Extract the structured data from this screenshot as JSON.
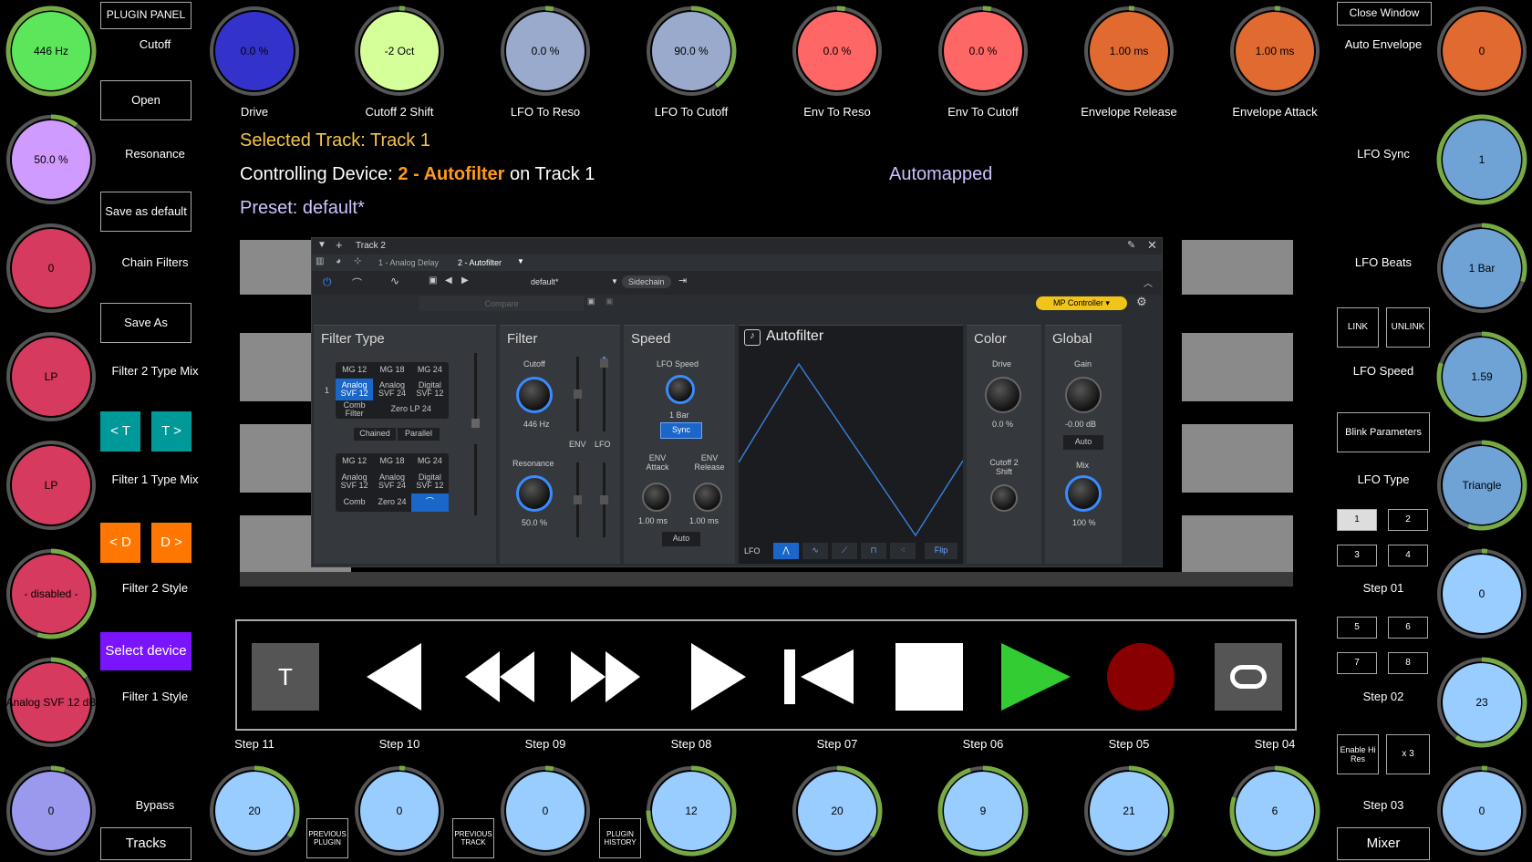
{
  "header": {
    "selected_prefix": "Selected Track: ",
    "selected_track": "Track 1",
    "controlling_prefix": "Controlling Device: ",
    "device": "2 - Autofilter",
    "on_track": "on Track 1",
    "preset": "Preset: default*",
    "automapped": "Automapped"
  },
  "colors": {
    "green": "#5ce65c",
    "lime": "#d4ff99",
    "purple": "#cf9bff",
    "blue": "#3333cc",
    "slate": "#99aacc",
    "red": "#ff6666",
    "orange": "#e06a30",
    "pink": "#d63a5e",
    "skyblue": "#99ccff",
    "ring_green": "#77aa44",
    "ring_dark": "#555555"
  },
  "left_knobs": [
    {
      "value": "446 Hz",
      "color": "#5ce65c"
    },
    {
      "value": "50.0 %",
      "color": "#cf9bff"
    },
    {
      "value": "0",
      "color": "#d63a5e"
    },
    {
      "value": "LP",
      "color": "#d63a5e"
    },
    {
      "value": "LP",
      "color": "#d63a5e"
    },
    {
      "value": "- disabled -",
      "color": "#d63a5e"
    },
    {
      "value": "Analog SVF 12 dB",
      "color": "#d63a5e"
    },
    {
      "value": "0",
      "color": "#9a99ee"
    }
  ],
  "left_labels": [
    "Cutoff",
    "Resonance",
    "Chain Filters",
    "Filter 2 Type Mix",
    "Filter 1 Type Mix",
    "Filter 2 Style",
    "Filter 1 Style",
    "Bypass"
  ],
  "left_buttons": {
    "plugin_panel": "PLUGIN PANEL",
    "open": "Open",
    "save_default": "Save as default",
    "save_as": "Save As",
    "prev_t": "< T",
    "next_t": "T >",
    "prev_d": "< D",
    "next_d": "D >",
    "select_device": "Select device",
    "tracks": "Tracks"
  },
  "top_knobs": [
    {
      "value": "0.0 %",
      "label": "Drive",
      "color": "#3333cc"
    },
    {
      "value": "-2 Oct",
      "label": "Cutoff 2 Shift",
      "color": "#d4ff99"
    },
    {
      "value": "0.0 %",
      "label": "LFO To Reso",
      "color": "#99aacc"
    },
    {
      "value": "90.0 %",
      "label": "LFO To Cutoff",
      "color": "#99aacc"
    },
    {
      "value": "0.0 %",
      "label": "Env To Reso",
      "color": "#ff6666"
    },
    {
      "value": "0.0 %",
      "label": "Env To Cutoff",
      "color": "#ff6666"
    },
    {
      "value": "1.00 ms",
      "label": "Envelope Release",
      "color": "#e06a30"
    },
    {
      "value": "1.00 ms",
      "label": "Envelope Attack",
      "color": "#e06a30"
    }
  ],
  "right_knobs": [
    {
      "value": "0",
      "color": "#e06a30"
    },
    {
      "value": "1",
      "color": "#6fa3d6"
    },
    {
      "value": "1 Bar",
      "color": "#6fa3d6"
    },
    {
      "value": "1.59",
      "color": "#6fa3d6"
    },
    {
      "value": "Triangle",
      "color": "#6fa3d6"
    },
    {
      "value": "0",
      "color": "#99ccff"
    },
    {
      "value": "23",
      "color": "#99ccff"
    },
    {
      "value": "0",
      "color": "#99ccff"
    }
  ],
  "right_labels": [
    "Auto Envelope",
    "LFO Sync",
    "LFO Beats",
    "LFO Speed",
    "LFO Type",
    "Step 01",
    "Step 02",
    "Step 03"
  ],
  "right_buttons": {
    "close": "Close Window",
    "link": "LINK",
    "unlink": "UNLINK",
    "blink": "Blink Parameters",
    "hires": "Enable Hi Res",
    "x3": "x 3",
    "mixer": "Mixer",
    "pages": [
      "1",
      "2",
      "3",
      "4",
      "5",
      "6",
      "7",
      "8"
    ]
  },
  "bottom_knobs": [
    {
      "value": "20",
      "label": "Step 11"
    },
    {
      "value": "0",
      "label": "Step 10"
    },
    {
      "value": "0",
      "label": "Step 09"
    },
    {
      "value": "12",
      "label": "Step 08"
    },
    {
      "value": "20",
      "label": "Step 07"
    },
    {
      "value": "9",
      "label": "Step 06"
    },
    {
      "value": "21",
      "label": "Step 05"
    },
    {
      "value": "6",
      "label": "Step 04"
    }
  ],
  "bottom_buttons": {
    "prev_plugin": "PREVIOUS PLUGIN",
    "prev_track": "PREVIOUS TRACK",
    "plugin_history": "PLUGIN HISTORY"
  },
  "transport": {
    "t_label": "T"
  },
  "plugin": {
    "track": "Track 2",
    "chain1": "1 - Analog Delay",
    "chain2": "2 - Autofilter",
    "preset": "default*",
    "sidechain": "Sidechain",
    "compare": "Compare",
    "controller": "MP Controller",
    "filter_type": "Filter Type",
    "row_num": "1",
    "grid1": [
      "MG 12",
      "MG 18",
      "MG 24",
      "Analog SVF 12",
      "Analog SVF 24",
      "Digital SVF 12",
      "Comb Filter",
      "Zero LP 24"
    ],
    "chained": "Chained",
    "parallel": "Parallel",
    "grid2": [
      "MG 12",
      "MG 18",
      "MG 24",
      "Analog SVF 12",
      "Analog SVF 24",
      "Digital SVF 12",
      "Comb",
      "Zero 24"
    ],
    "filter": "Filter",
    "cutoff": "Cutoff",
    "cutoff_val": "446 Hz",
    "resonance": "Resonance",
    "resonance_val": "50.0 %",
    "env": "ENV",
    "lfo": "LFO",
    "speed": "Speed",
    "lfo_speed": "LFO Speed",
    "bar": "1 Bar",
    "sync": "Sync",
    "env_attack": "ENV Attack",
    "env_release": "ENV Release",
    "att_val": "1.00 ms",
    "rel_val": "1.00 ms",
    "auto": "Auto",
    "title": "Autofilter",
    "lfo_label": "LFO",
    "flip": "Flip",
    "color": "Color",
    "drive": "Drive",
    "drive_val": "0.0 %",
    "cutoff2": "Cutoff 2 Shift",
    "global": "Global",
    "gain": "Gain",
    "gain_val": "-0.00 dB",
    "gauto": "Auto",
    "mix": "Mix",
    "mix_val": "100 %"
  }
}
